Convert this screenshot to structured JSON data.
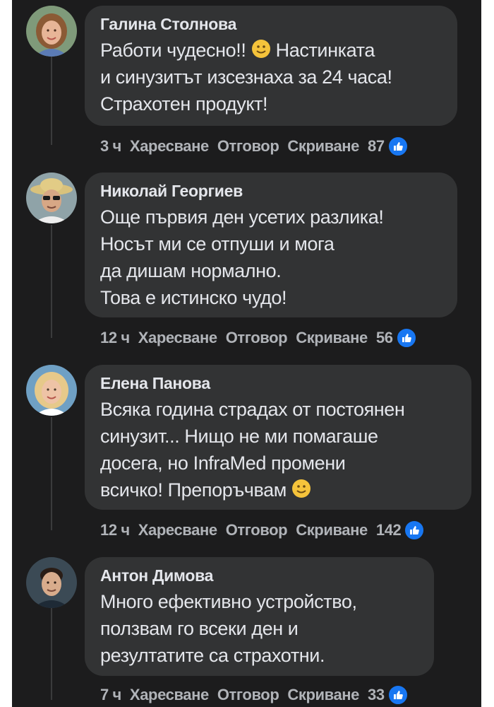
{
  "comments": [
    {
      "author": "Галина Столнова",
      "text_before": "Работи чудесно!! ",
      "text_after": " Настинката\nи синузитът изсезнаха за 24 часа!\nСтрахотен продукт!",
      "time": "3 ч",
      "like_label": "Харесване",
      "reply_label": "Отговор",
      "hide_label": "Скриване",
      "reactions": "87"
    },
    {
      "author": "Николай Георгиев",
      "text": "Още първия ден усетих разлика!\nНосът ми се отпуши и мога\nда дишам нормално.\nТова е истинско чудо!",
      "time": "12 ч",
      "like_label": "Харесване",
      "reply_label": "Отговор",
      "hide_label": "Скриване",
      "reactions": "56"
    },
    {
      "author": "Елена Панова",
      "text_before": "Всяка година страдах от постоянен\nсинузит... Нищо не ми помагаше\nдосега, но InfraMed промени\nвсичко! Препоръчвам ",
      "text_after": "",
      "time": "12 ч",
      "like_label": "Харесване",
      "reply_label": "Отговор",
      "hide_label": "Скриване",
      "reactions": "142"
    },
    {
      "author": "Антон Димова",
      "text": "Много ефективно устройство,\nползвам го всеки ден и\nрезултатите са страхотни.",
      "time": "7 ч",
      "like_label": "Харесване",
      "reply_label": "Отговор",
      "hide_label": "Скриване",
      "reactions": "33"
    }
  ],
  "colors": {
    "background": "#1c1c1d",
    "bubble": "#323334",
    "text": "#e4e6eb",
    "meta": "#b0b3b8",
    "like_badge": "#1877f2"
  }
}
